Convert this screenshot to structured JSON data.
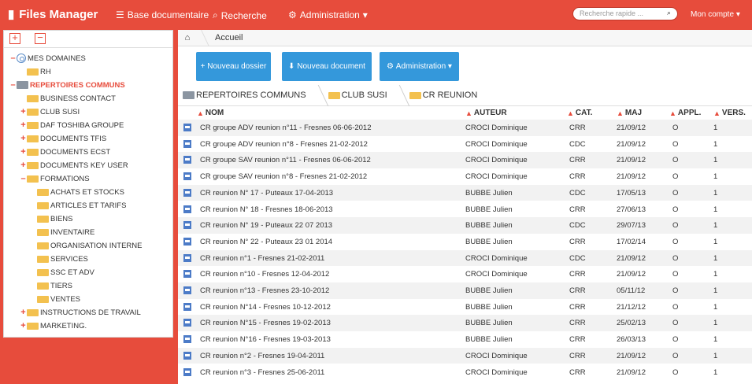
{
  "app": {
    "title": "Files Manager",
    "accent": "#e74c3c",
    "button_color": "#3498db"
  },
  "nav": [
    {
      "label": "Base documentaire",
      "icon": "database-icon"
    },
    {
      "label": "Recherche",
      "icon": "search-icon"
    },
    {
      "label": "Administration",
      "icon": "gear-icon"
    }
  ],
  "search": {
    "placeholder": "Recherche rapide ..."
  },
  "account": "Mon compte",
  "tree": [
    {
      "label": "MES DOMAINES",
      "level": 0,
      "toggle": "–",
      "icon": "globe"
    },
    {
      "label": "RH",
      "level": 1,
      "toggle": "",
      "icon": "folder"
    },
    {
      "label": "REPERTOIRES COMMUNS",
      "level": 0,
      "toggle": "–",
      "icon": "server",
      "active": true
    },
    {
      "label": "BUSINESS CONTACT",
      "level": 1,
      "toggle": "",
      "icon": "folder"
    },
    {
      "label": "CLUB SUSI",
      "level": 1,
      "toggle": "+",
      "icon": "folder"
    },
    {
      "label": "DAF TOSHIBA GROUPE",
      "level": 1,
      "toggle": "+",
      "icon": "folder"
    },
    {
      "label": "DOCUMENTS TFIS",
      "level": 1,
      "toggle": "+",
      "icon": "folder"
    },
    {
      "label": "DOCUMENTS ECST",
      "level": 1,
      "toggle": "+",
      "icon": "folder"
    },
    {
      "label": "DOCUMENTS KEY USER",
      "level": 1,
      "toggle": "+",
      "icon": "folder"
    },
    {
      "label": "FORMATIONS",
      "level": 1,
      "toggle": "–",
      "icon": "folder"
    },
    {
      "label": "ACHATS ET STOCKS",
      "level": 2,
      "toggle": "",
      "icon": "folder"
    },
    {
      "label": "ARTICLES ET TARIFS",
      "level": 2,
      "toggle": "",
      "icon": "folder"
    },
    {
      "label": "BIENS",
      "level": 2,
      "toggle": "",
      "icon": "folder"
    },
    {
      "label": "INVENTAIRE",
      "level": 2,
      "toggle": "",
      "icon": "folder"
    },
    {
      "label": "ORGANISATION INTERNE",
      "level": 2,
      "toggle": "",
      "icon": "folder"
    },
    {
      "label": "SERVICES",
      "level": 2,
      "toggle": "",
      "icon": "folder"
    },
    {
      "label": "SSC ET ADV",
      "level": 2,
      "toggle": "",
      "icon": "folder"
    },
    {
      "label": "TIERS",
      "level": 2,
      "toggle": "",
      "icon": "folder"
    },
    {
      "label": "VENTES",
      "level": 2,
      "toggle": "",
      "icon": "folder"
    },
    {
      "label": "INSTRUCTIONS DE TRAVAIL",
      "level": 1,
      "toggle": "+",
      "icon": "folder"
    },
    {
      "label": "MARKETING.",
      "level": 1,
      "toggle": "+",
      "icon": "folder"
    }
  ],
  "breadcrumb": {
    "home": "Accueil"
  },
  "actions": [
    {
      "label": "+ Nouveau dossier"
    },
    {
      "label": "Nouveau document"
    },
    {
      "label": "Administration"
    }
  ],
  "path": [
    {
      "label": "REPERTOIRES COMMUNS",
      "icon": "server-icon"
    },
    {
      "label": "CLUB SUSI",
      "icon": "folder-icon"
    },
    {
      "label": "CR REUNION",
      "icon": "folder-icon"
    }
  ],
  "columns": [
    "NOM",
    "AUTEUR",
    "CAT.",
    "MAJ",
    "APPL.",
    "VERS."
  ],
  "rows": [
    [
      "CR groupe ADV reunion n°11 - Fresnes 06-06-2012",
      "CROCI Dominique",
      "CRR",
      "21/09/12",
      "O",
      "1"
    ],
    [
      "CR groupe ADV reunion n°8 - Fresnes 21-02-2012",
      "CROCI Dominique",
      "CDC",
      "21/09/12",
      "O",
      "1"
    ],
    [
      "CR groupe SAV reunion n°11 - Fresnes 06-06-2012",
      "CROCI Dominique",
      "CRR",
      "21/09/12",
      "O",
      "1"
    ],
    [
      "CR groupe SAV reunion n°8 - Fresnes 21-02-2012",
      "CROCI Dominique",
      "CRR",
      "21/09/12",
      "O",
      "1"
    ],
    [
      "CR reunion N° 17 - Puteaux 17-04-2013",
      "BUBBE Julien",
      "CDC",
      "17/05/13",
      "O",
      "1"
    ],
    [
      "CR reunion N° 18 - Fresnes 18-06-2013",
      "BUBBE Julien",
      "CRR",
      "27/06/13",
      "O",
      "1"
    ],
    [
      "CR reunion N° 19 - Puteaux 22 07 2013",
      "BUBBE Julien",
      "CDC",
      "29/07/13",
      "O",
      "1"
    ],
    [
      "CR reunion N° 22 - Puteaux 23 01 2014",
      "BUBBE Julien",
      "CRR",
      "17/02/14",
      "O",
      "1"
    ],
    [
      "CR reunion n°1 - Fresnes 21-02-2011",
      "CROCI Dominique",
      "CDC",
      "21/09/12",
      "O",
      "1"
    ],
    [
      "CR reunion n°10 - Fresnes 12-04-2012",
      "CROCI Dominique",
      "CRR",
      "21/09/12",
      "O",
      "1"
    ],
    [
      "CR reunion n°13 - Fresnes 23-10-2012",
      "BUBBE Julien",
      "CRR",
      "05/11/12",
      "O",
      "1"
    ],
    [
      "CR reunion N°14 - Fresnes 10-12-2012",
      "BUBBE Julien",
      "CRR",
      "21/12/12",
      "O",
      "1"
    ],
    [
      "CR reunion N°15 - Fresnes 19-02-2013",
      "BUBBE Julien",
      "CRR",
      "25/02/13",
      "O",
      "1"
    ],
    [
      "CR reunion N°16 - Fresnes 19-03-2013",
      "BUBBE Julien",
      "CRR",
      "26/03/13",
      "O",
      "1"
    ],
    [
      "CR reunion n°2 - Fresnes 19-04-2011",
      "CROCI Dominique",
      "CRR",
      "21/09/12",
      "O",
      "1"
    ],
    [
      "CR reunion n°3 - Fresnes 25-06-2011",
      "CROCI Dominique",
      "CRR",
      "21/09/12",
      "O",
      "1"
    ]
  ]
}
